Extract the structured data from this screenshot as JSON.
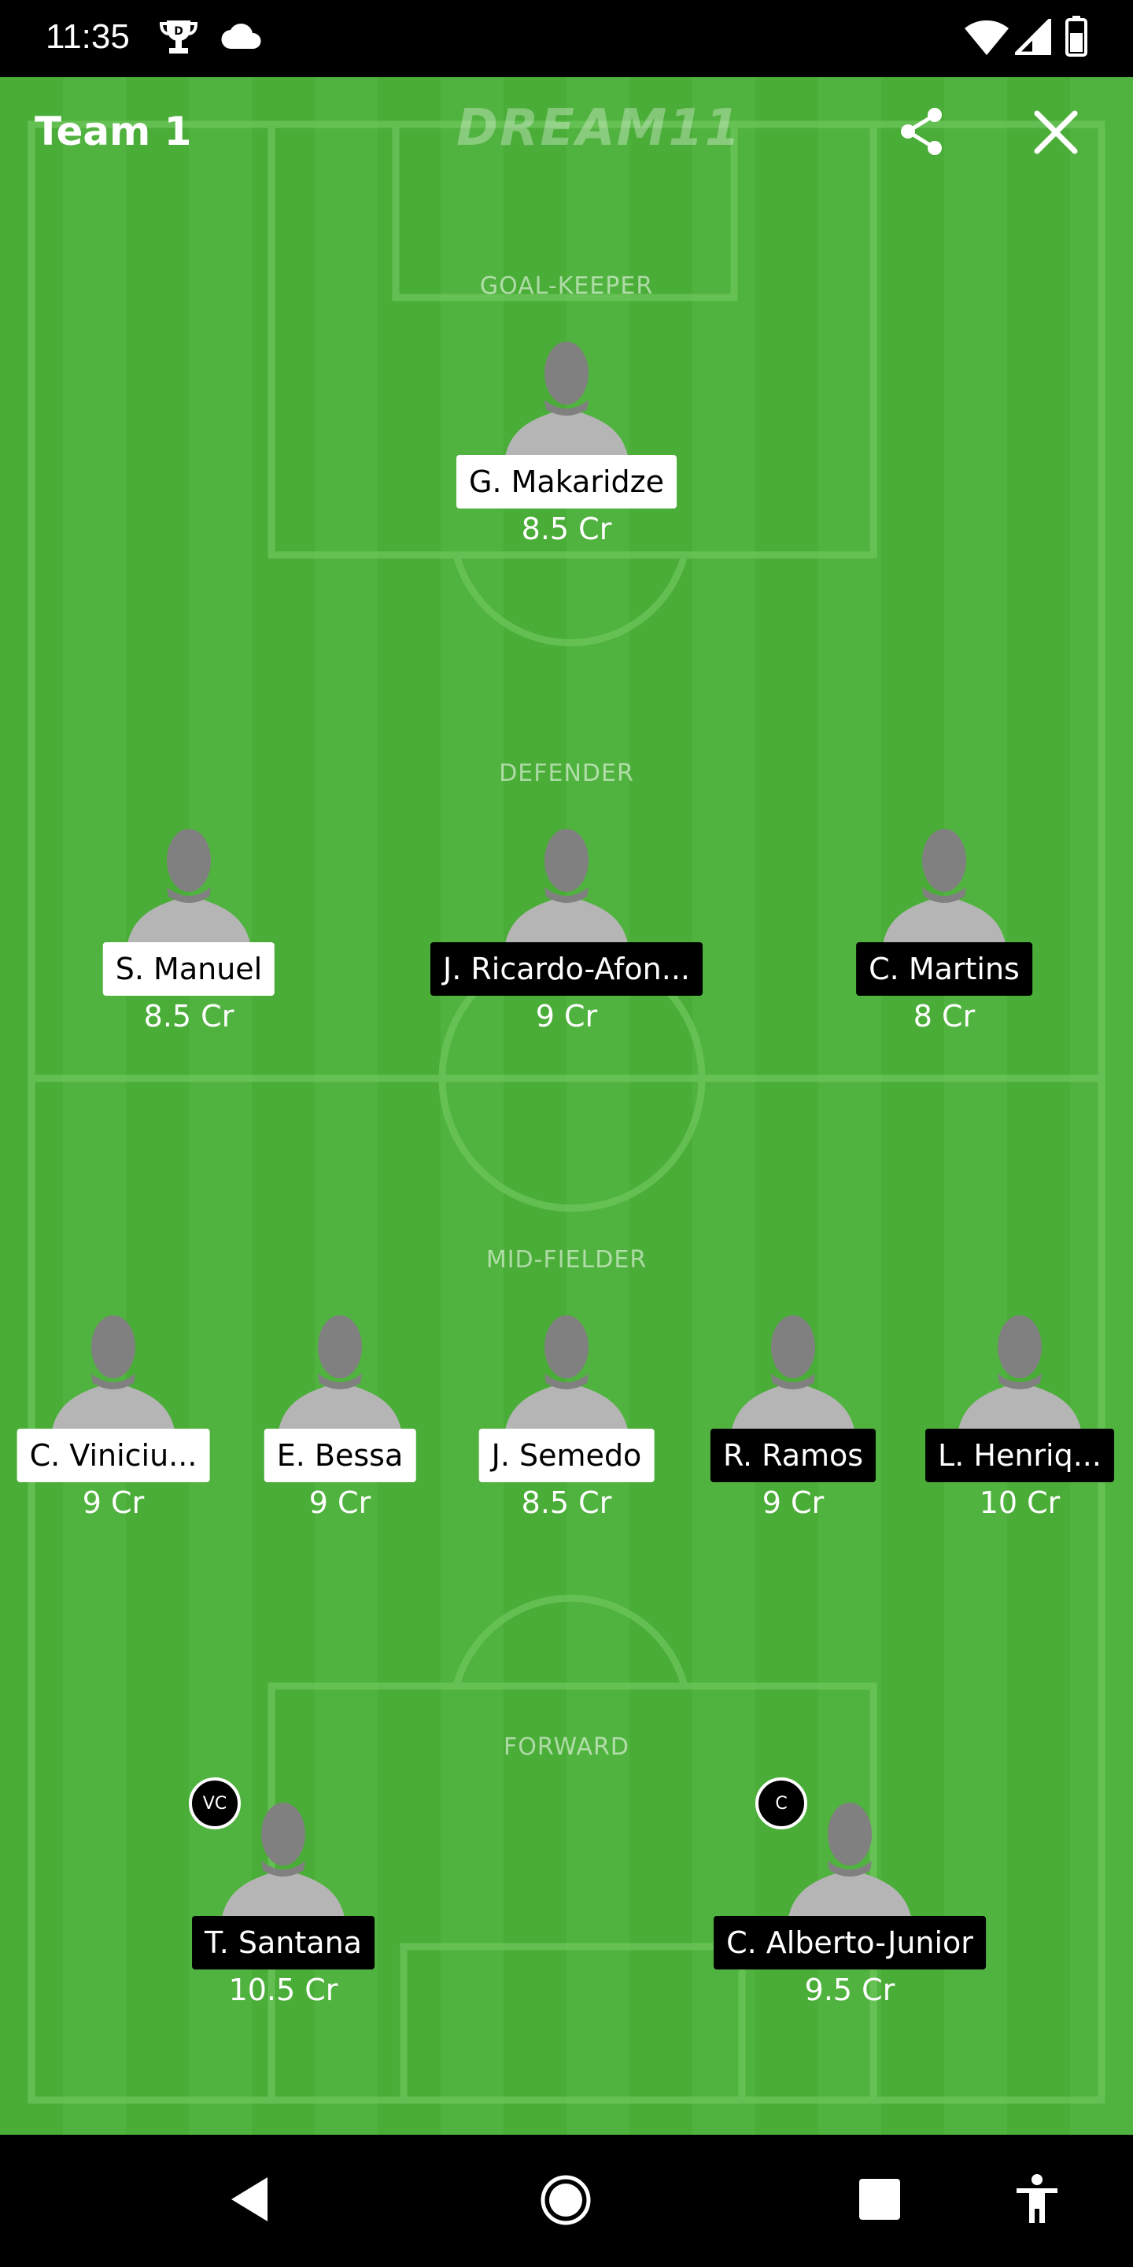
{
  "status_bar": {
    "time": "11:35",
    "icons_left": [
      "trophy-icon",
      "cloud-icon"
    ],
    "icons_right": [
      "wifi-icon",
      "signal-icon",
      "battery-icon"
    ]
  },
  "header": {
    "team_name": "Team 1",
    "brand": "DREAM11",
    "share_icon": "share-icon",
    "close_icon": "close-icon"
  },
  "sections": {
    "goalkeeper": "GOAL-KEEPER",
    "defender": "DEFENDER",
    "midfielder": "MID-FIELDER",
    "forward": "FORWARD"
  },
  "players": {
    "goalkeepers": [
      {
        "name": "G. Makaridze",
        "credit": "8.5 Cr",
        "team": "a"
      }
    ],
    "defenders": [
      {
        "name": "S. Manuel",
        "credit": "8.5 Cr",
        "team": "a"
      },
      {
        "name": "J. Ricardo-Afon...",
        "credit": "9 Cr",
        "team": "b"
      },
      {
        "name": "C. Martins",
        "credit": "8 Cr",
        "team": "b"
      }
    ],
    "midfielders": [
      {
        "name": "C. Viniciu...",
        "credit": "9 Cr",
        "team": "a"
      },
      {
        "name": "E. Bessa",
        "credit": "9 Cr",
        "team": "a"
      },
      {
        "name": "J. Semedo",
        "credit": "8.5 Cr",
        "team": "a"
      },
      {
        "name": "R. Ramos",
        "credit": "9 Cr",
        "team": "b"
      },
      {
        "name": "L. Henriq...",
        "credit": "10 Cr",
        "team": "b"
      }
    ],
    "forwards": [
      {
        "name": "T. Santana",
        "credit": "10.5 Cr",
        "team": "b",
        "badge": "VC"
      },
      {
        "name": "C. Alberto-Junior",
        "credit": "9.5 Cr",
        "team": "b",
        "badge": "C"
      }
    ]
  },
  "nav": {
    "back": "back-icon",
    "home": "home-icon",
    "recents": "recents-icon",
    "accessibility": "accessibility-icon"
  }
}
